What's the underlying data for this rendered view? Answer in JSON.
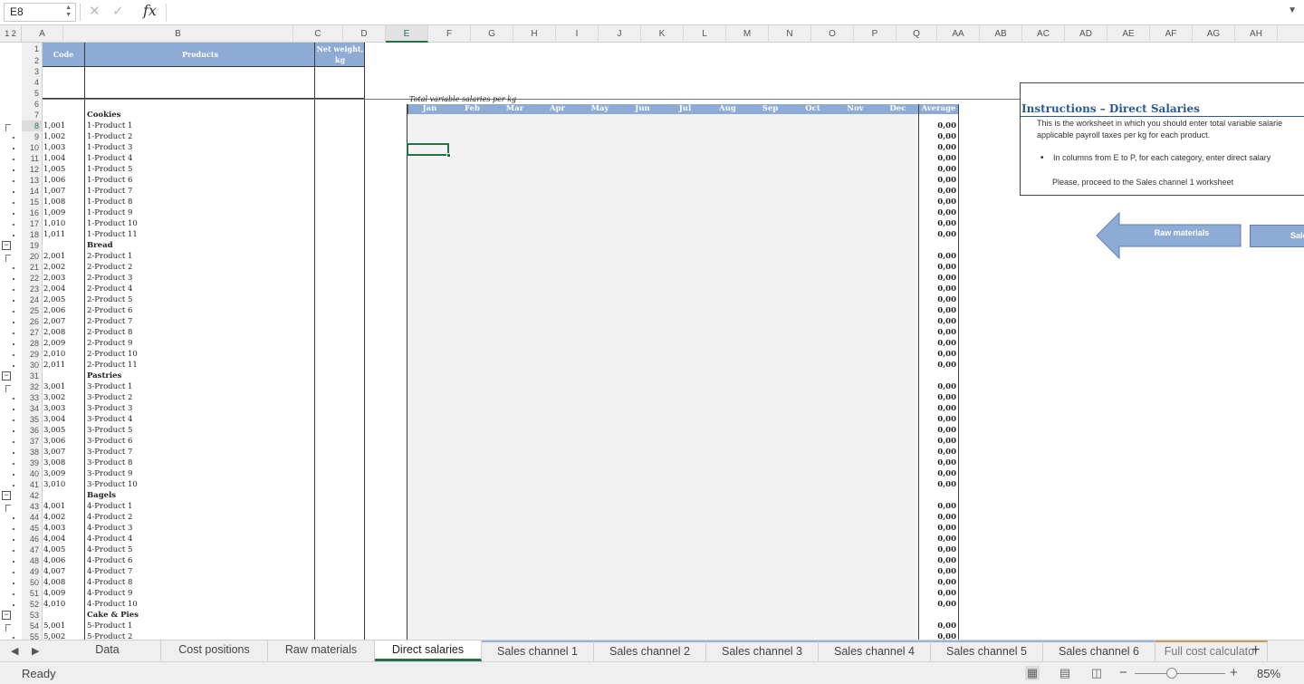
{
  "formula_bar": {
    "name_box": "E8",
    "fx_label": "fx",
    "formula": ""
  },
  "outline_levels": "1 2",
  "columns": [
    {
      "label": "A",
      "w": 46
    },
    {
      "label": "B",
      "w": 254
    },
    {
      "label": "C",
      "w": 55
    },
    {
      "label": "D",
      "w": 47
    },
    {
      "label": "E",
      "w": 47,
      "selected": true
    },
    {
      "label": "F",
      "w": 47
    },
    {
      "label": "G",
      "w": 47
    },
    {
      "label": "H",
      "w": 47
    },
    {
      "label": "I",
      "w": 47
    },
    {
      "label": "J",
      "w": 47
    },
    {
      "label": "K",
      "w": 47
    },
    {
      "label": "L",
      "w": 47
    },
    {
      "label": "M",
      "w": 47
    },
    {
      "label": "N",
      "w": 47
    },
    {
      "label": "O",
      "w": 47
    },
    {
      "label": "P",
      "w": 47
    },
    {
      "label": "Q",
      "w": 45
    },
    {
      "label": "AA",
      "w": 47
    },
    {
      "label": "AB",
      "w": 47
    },
    {
      "label": "AC",
      "w": 47
    },
    {
      "label": "AD",
      "w": 47
    },
    {
      "label": "AE",
      "w": 47
    },
    {
      "label": "AF",
      "w": 47
    },
    {
      "label": "AG",
      "w": 47
    },
    {
      "label": "AH",
      "w": 47
    }
  ],
  "header": {
    "code": "Code",
    "products": "Products",
    "net_weight": "Net weight, kg"
  },
  "section_title": "Total variable salaries per kg",
  "months": [
    "Jan",
    "Feb",
    "Mar",
    "Apr",
    "May",
    "Jun",
    "Jul",
    "Aug",
    "Sep",
    "Oct",
    "Nov",
    "Dec"
  ],
  "average_label": "Average",
  "rows": [
    {
      "r": 1
    },
    {
      "r": 2
    },
    {
      "r": 3
    },
    {
      "r": 4
    },
    {
      "r": 5
    },
    {
      "r": 6
    },
    {
      "r": 7,
      "product": "Cookies",
      "cat": true
    },
    {
      "r": 8,
      "code": "1,001",
      "product": "1-Product 1",
      "avg": "0,00"
    },
    {
      "r": 9,
      "code": "1,002",
      "product": "1-Product 2",
      "avg": "0,00"
    },
    {
      "r": 10,
      "code": "1,003",
      "product": "1-Product 3",
      "avg": "0,00"
    },
    {
      "r": 11,
      "code": "1,004",
      "product": "1-Product 4",
      "avg": "0,00"
    },
    {
      "r": 12,
      "code": "1,005",
      "product": "1-Product 5",
      "avg": "0,00"
    },
    {
      "r": 13,
      "code": "1,006",
      "product": "1-Product 6",
      "avg": "0,00"
    },
    {
      "r": 14,
      "code": "1,007",
      "product": "1-Product 7",
      "avg": "0,00"
    },
    {
      "r": 15,
      "code": "1,008",
      "product": "1-Product 8",
      "avg": "0,00"
    },
    {
      "r": 16,
      "code": "1,009",
      "product": "1-Product 9",
      "avg": "0,00"
    },
    {
      "r": 17,
      "code": "1,010",
      "product": "1-Product 10",
      "avg": "0,00"
    },
    {
      "r": 18,
      "code": "1,011",
      "product": "1-Product 11",
      "avg": "0,00"
    },
    {
      "r": 19,
      "product": "Bread",
      "cat": true
    },
    {
      "r": 20,
      "code": "2,001",
      "product": "2-Product 1",
      "avg": "0,00"
    },
    {
      "r": 21,
      "code": "2,002",
      "product": "2-Product 2",
      "avg": "0,00"
    },
    {
      "r": 22,
      "code": "2,003",
      "product": "2-Product 3",
      "avg": "0,00"
    },
    {
      "r": 23,
      "code": "2,004",
      "product": "2-Product 4",
      "avg": "0,00"
    },
    {
      "r": 24,
      "code": "2,005",
      "product": "2-Product 5",
      "avg": "0,00"
    },
    {
      "r": 25,
      "code": "2,006",
      "product": "2-Product 6",
      "avg": "0,00"
    },
    {
      "r": 26,
      "code": "2,007",
      "product": "2-Product 7",
      "avg": "0,00"
    },
    {
      "r": 27,
      "code": "2,008",
      "product": "2-Product 8",
      "avg": "0,00"
    },
    {
      "r": 28,
      "code": "2,009",
      "product": "2-Product 9",
      "avg": "0,00"
    },
    {
      "r": 29,
      "code": "2,010",
      "product": "2-Product 10",
      "avg": "0,00"
    },
    {
      "r": 30,
      "code": "2,011",
      "product": "2-Product 11",
      "avg": "0,00"
    },
    {
      "r": 31,
      "product": "Pastries",
      "cat": true
    },
    {
      "r": 32,
      "code": "3,001",
      "product": "3-Product 1",
      "avg": "0,00"
    },
    {
      "r": 33,
      "code": "3,002",
      "product": "3-Product 2",
      "avg": "0,00"
    },
    {
      "r": 34,
      "code": "3,003",
      "product": "3-Product 3",
      "avg": "0,00"
    },
    {
      "r": 35,
      "code": "3,004",
      "product": "3-Product 4",
      "avg": "0,00"
    },
    {
      "r": 36,
      "code": "3,005",
      "product": "3-Product 5",
      "avg": "0,00"
    },
    {
      "r": 37,
      "code": "3,006",
      "product": "3-Product 6",
      "avg": "0,00"
    },
    {
      "r": 38,
      "code": "3,007",
      "product": "3-Product 7",
      "avg": "0,00"
    },
    {
      "r": 39,
      "code": "3,008",
      "product": "3-Product 8",
      "avg": "0,00"
    },
    {
      "r": 40,
      "code": "3,009",
      "product": "3-Product 9",
      "avg": "0,00"
    },
    {
      "r": 41,
      "code": "3,010",
      "product": "3-Product 10",
      "avg": "0,00"
    },
    {
      "r": 42,
      "product": "Bagels",
      "cat": true
    },
    {
      "r": 43,
      "code": "4,001",
      "product": "4-Product 1",
      "avg": "0,00"
    },
    {
      "r": 44,
      "code": "4,002",
      "product": "4-Product 2",
      "avg": "0,00"
    },
    {
      "r": 45,
      "code": "4,003",
      "product": "4-Product 3",
      "avg": "0,00"
    },
    {
      "r": 46,
      "code": "4,004",
      "product": "4-Product 4",
      "avg": "0,00"
    },
    {
      "r": 47,
      "code": "4,005",
      "product": "4-Product 5",
      "avg": "0,00"
    },
    {
      "r": 48,
      "code": "4,006",
      "product": "4-Product 6",
      "avg": "0,00"
    },
    {
      "r": 49,
      "code": "4,007",
      "product": "4-Product 7",
      "avg": "0,00"
    },
    {
      "r": 50,
      "code": "4,008",
      "product": "4-Product 8",
      "avg": "0,00"
    },
    {
      "r": 51,
      "code": "4,009",
      "product": "4-Product 9",
      "avg": "0,00"
    },
    {
      "r": 52,
      "code": "4,010",
      "product": "4-Product 10",
      "avg": "0,00"
    },
    {
      "r": 53,
      "product": "Cake & Pies",
      "cat": true
    },
    {
      "r": 54,
      "code": "5,001",
      "product": "5-Product 1",
      "avg": "0,00"
    },
    {
      "r": 55,
      "code": "5,002",
      "product": "5-Product 2",
      "avg": "0,00"
    }
  ],
  "instructions": {
    "title": "Instructions – Direct Salaries",
    "line1": "This is the worksheet in which you should enter total variable salarie",
    "line2": "applicable payroll taxes per kg for each product.",
    "bullet": "In columns from E to P, for each category, enter direct salary",
    "line3": "Please, proceed to the Sales channel 1 worksheet"
  },
  "buttons": {
    "back": "Raw materials",
    "next": "Sale"
  },
  "sheet_tabs": [
    {
      "label": "Data",
      "w": 118
    },
    {
      "label": "Cost positions",
      "w": 118
    },
    {
      "label": "Raw materials",
      "w": 118
    },
    {
      "label": "Direct salaries",
      "w": 118,
      "active": true
    },
    {
      "label": "Sales channel 1",
      "w": 124,
      "style": "under"
    },
    {
      "label": "Sales channel 2",
      "w": 124,
      "style": "under"
    },
    {
      "label": "Sales channel 3",
      "w": 124,
      "style": "under"
    },
    {
      "label": "Sales channel 4",
      "w": 124,
      "style": "under"
    },
    {
      "label": "Sales channel 5",
      "w": 124,
      "style": "under"
    },
    {
      "label": "Sales channel 6",
      "w": 124,
      "style": "under"
    },
    {
      "label": "Full cost calculator",
      "w": 124,
      "style": "muted"
    }
  ],
  "status": {
    "ready": "Ready",
    "zoom": "85%"
  },
  "colors": {
    "accent": "#217346",
    "header_blue": "#8eabd6",
    "title_blue": "#2c5a92"
  }
}
